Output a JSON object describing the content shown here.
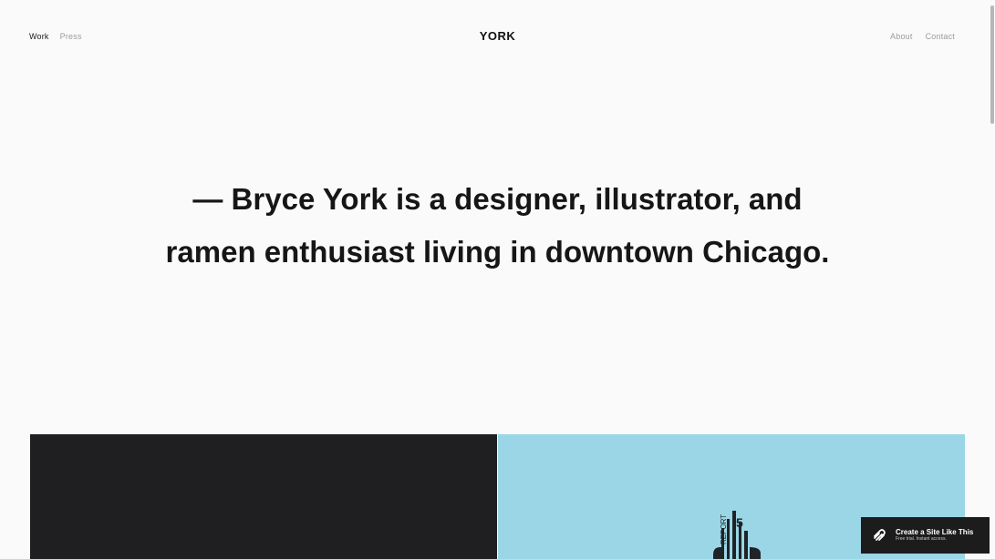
{
  "nav": {
    "left_items": [
      "Work",
      "Press"
    ],
    "right_items": [
      "About",
      "Contact"
    ]
  },
  "brand": {
    "logo": "YORK"
  },
  "intro": {
    "line1": "— Bryce York is a designer, illustrator, and",
    "line2": "ramen enthusiast living in downtown Chicago."
  },
  "cta": {
    "title": "Create a Site Like This",
    "subtitle": "Free trial. Instant access."
  },
  "artwork": {
    "poster_label": "REPORT",
    "poster_number": "5"
  },
  "colors": {
    "background": "#fafafa",
    "text": "#161616",
    "muted_nav": "#9b9b9b",
    "gallery_dark": "#1f1f21",
    "gallery_blue": "#9ad6e6",
    "cta_background": "#1c1c1c"
  }
}
